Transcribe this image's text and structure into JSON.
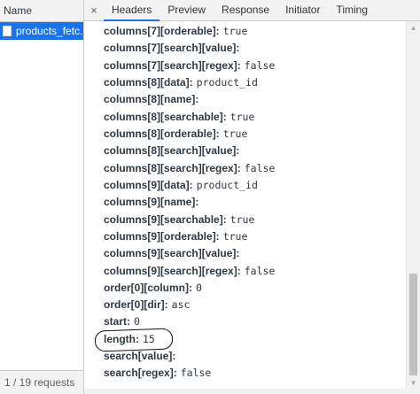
{
  "left_panel": {
    "header": "Name",
    "request_name": "products_fetc...",
    "footer": "1 / 19 requests"
  },
  "tabs": {
    "close": "×",
    "items": [
      "Headers",
      "Preview",
      "Response",
      "Initiator",
      "Timing"
    ],
    "active": "Headers"
  },
  "rows": [
    {
      "key": "columns[7][orderable]:",
      "value": "true"
    },
    {
      "key": "columns[7][search][value]:",
      "value": ""
    },
    {
      "key": "columns[7][search][regex]:",
      "value": "false"
    },
    {
      "key": "columns[8][data]:",
      "value": "product_id"
    },
    {
      "key": "columns[8][name]:",
      "value": ""
    },
    {
      "key": "columns[8][searchable]:",
      "value": "true"
    },
    {
      "key": "columns[8][orderable]:",
      "value": "true"
    },
    {
      "key": "columns[8][search][value]:",
      "value": ""
    },
    {
      "key": "columns[8][search][regex]:",
      "value": "false"
    },
    {
      "key": "columns[9][data]:",
      "value": "product_id"
    },
    {
      "key": "columns[9][name]:",
      "value": ""
    },
    {
      "key": "columns[9][searchable]:",
      "value": "true"
    },
    {
      "key": "columns[9][orderable]:",
      "value": "true"
    },
    {
      "key": "columns[9][search][value]:",
      "value": ""
    },
    {
      "key": "columns[9][search][regex]:",
      "value": "false"
    },
    {
      "key": "order[0][column]:",
      "value": "0"
    },
    {
      "key": "order[0][dir]:",
      "value": "asc"
    },
    {
      "key": "start:",
      "value": "0"
    },
    {
      "key": "length:",
      "value": "15"
    },
    {
      "key": "search[value]:",
      "value": ""
    },
    {
      "key": "search[regex]:",
      "value": "false"
    }
  ],
  "colors": {
    "accent": "#1a73e8",
    "selected_row": "#1a73e8",
    "panel_bg": "#f3f3f3"
  }
}
